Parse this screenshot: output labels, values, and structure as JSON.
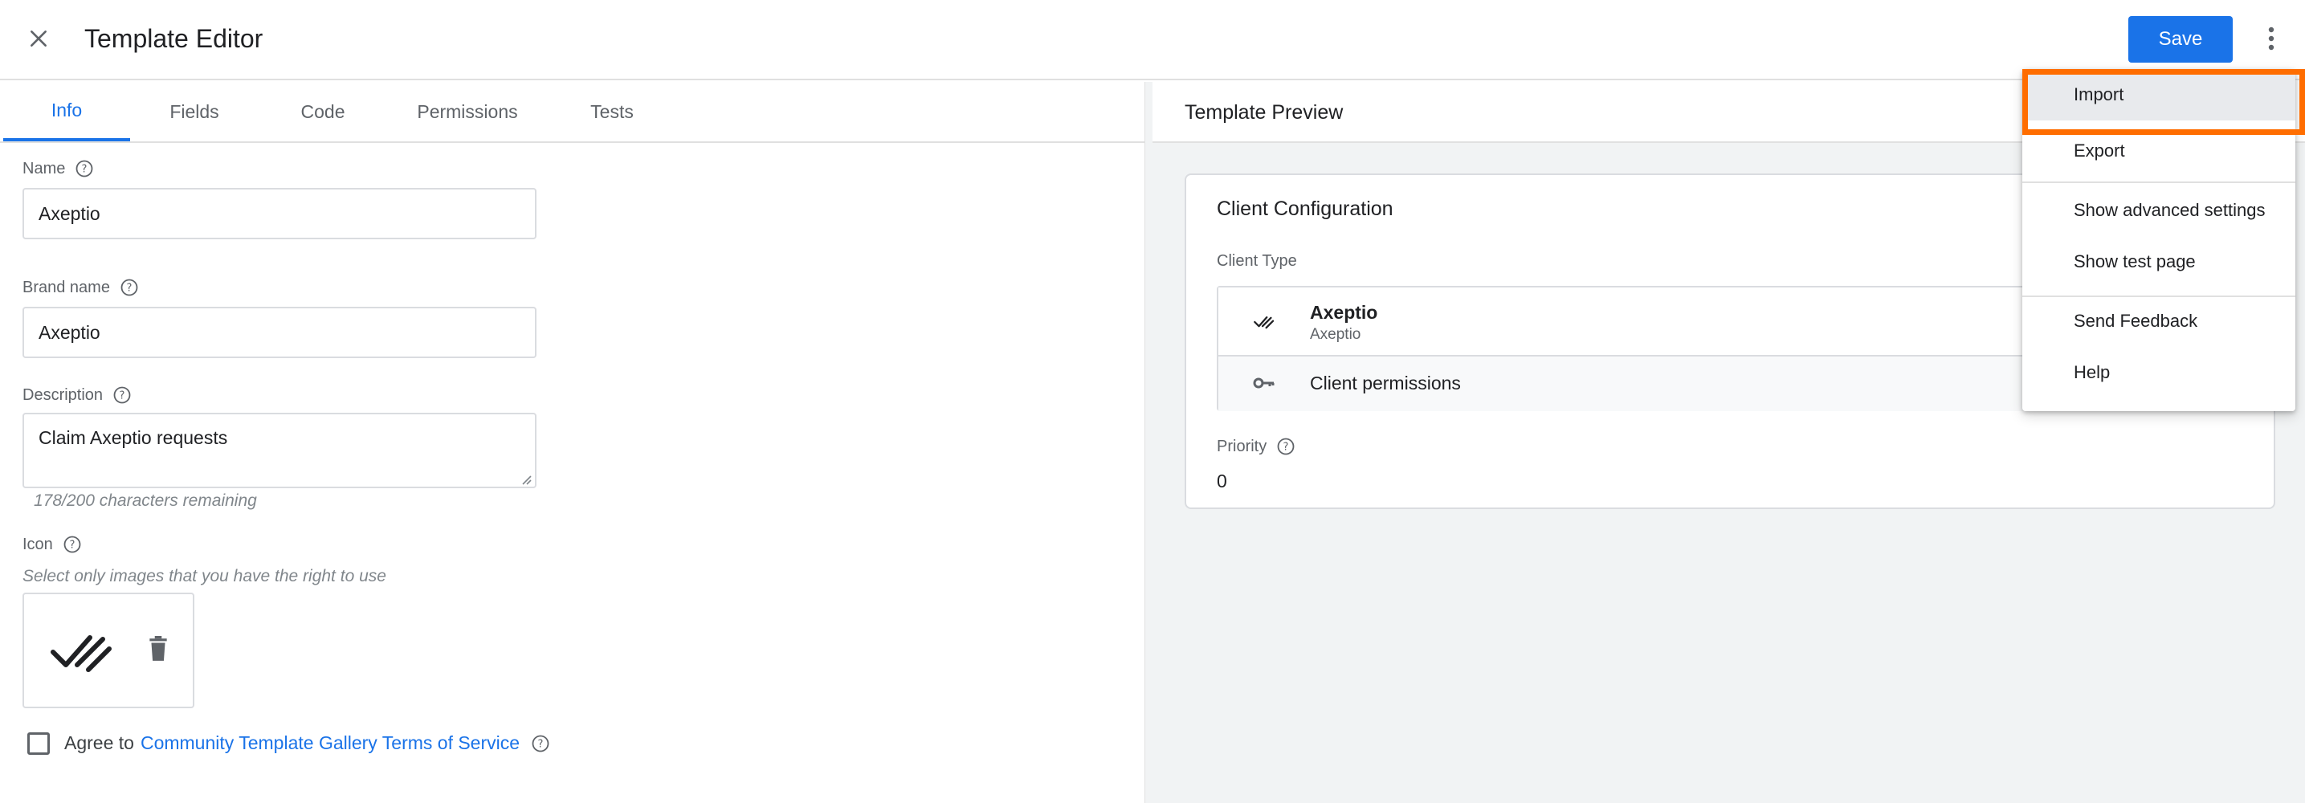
{
  "header": {
    "title": "Template Editor",
    "save_label": "Save"
  },
  "tabs": [
    {
      "label": "Info",
      "active": true
    },
    {
      "label": "Fields",
      "active": false
    },
    {
      "label": "Code",
      "active": false
    },
    {
      "label": "Permissions",
      "active": false
    },
    {
      "label": "Tests",
      "active": false
    }
  ],
  "form": {
    "name_label": "Name",
    "name_value": "Axeptio",
    "brand_label": "Brand name",
    "brand_value": "Axeptio",
    "description_label": "Description",
    "description_value": "Claim Axeptio requests",
    "description_hint": "178/200 characters remaining",
    "icon_label": "Icon",
    "icon_hint": "Select only images that you have the right to use",
    "agree_text": "Agree to",
    "agree_link": "Community Template Gallery Terms of Service"
  },
  "preview": {
    "title": "Template Preview",
    "card_title": "Client Configuration",
    "client_type_label": "Client Type",
    "client_name": "Axeptio",
    "client_sub": "Axeptio",
    "permissions_label": "Client permissions",
    "priority_label": "Priority",
    "priority_value": "0"
  },
  "menu": {
    "items": [
      {
        "label": "Import"
      },
      {
        "label": "Export"
      },
      {
        "label": "Show advanced settings"
      },
      {
        "label": "Show test page"
      },
      {
        "label": "Send Feedback"
      },
      {
        "label": "Help"
      }
    ],
    "highlight_color": "#ff6d00"
  },
  "colors": {
    "accent": "#1a73e8",
    "highlight": "#ff6d00"
  },
  "icons": {
    "close": "close-icon",
    "more": "more-vert-icon",
    "help": "help-circle-icon",
    "delete": "trash-icon",
    "checkmarks": "axeptio-check-icon",
    "key": "key-icon"
  }
}
